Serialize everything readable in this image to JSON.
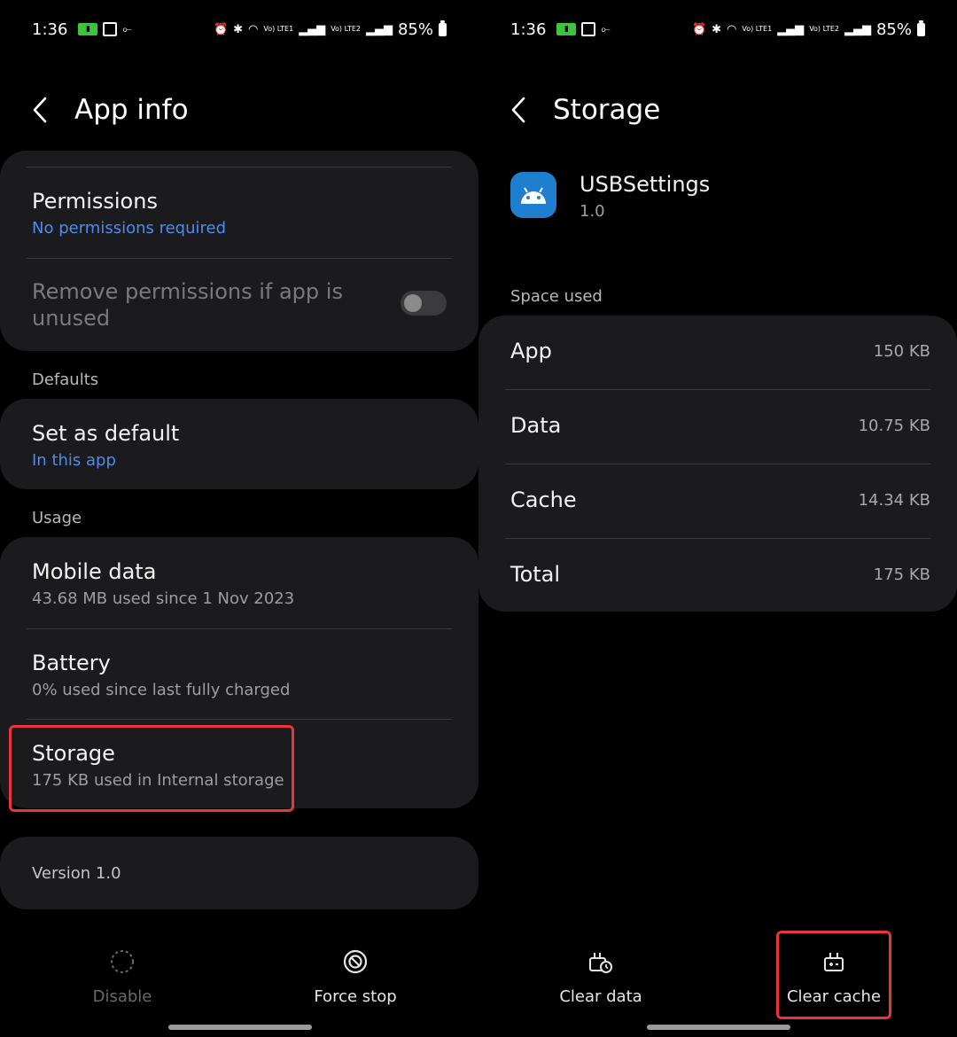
{
  "status_bar": {
    "time": "1:36",
    "battery": "85%",
    "net1": "Vo) LTE1",
    "net2": "Vo) LTE2"
  },
  "left": {
    "title": "App info",
    "permissions": {
      "title": "Permissions",
      "subtitle": "No permissions required"
    },
    "remove_perms": {
      "title": "Remove permissions if app is unused",
      "enabled": false
    },
    "defaults_label": "Defaults",
    "set_default": {
      "title": "Set as default",
      "subtitle": "In this app"
    },
    "usage_label": "Usage",
    "mobile_data": {
      "title": "Mobile data",
      "subtitle": "43.68 MB used since 1 Nov 2023"
    },
    "battery": {
      "title": "Battery",
      "subtitle": "0% used since last fully charged"
    },
    "storage": {
      "title": "Storage",
      "subtitle": "175 KB used in Internal storage"
    },
    "version": "Version 1.0",
    "disable_label": "Disable",
    "force_stop_label": "Force stop"
  },
  "right": {
    "title": "Storage",
    "app_name": "USBSettings",
    "app_version": "1.0",
    "space_used_label": "Space used",
    "rows": [
      {
        "key": "App",
        "value": "150 KB"
      },
      {
        "key": "Data",
        "value": "10.75 KB"
      },
      {
        "key": "Cache",
        "value": "14.34 KB"
      },
      {
        "key": "Total",
        "value": "175 KB"
      }
    ],
    "clear_data_label": "Clear data",
    "clear_cache_label": "Clear cache"
  },
  "colors": {
    "accent_blue": "#4c8cf2",
    "highlight_red": "#e8363c",
    "card_bg": "#1b1b1d"
  }
}
